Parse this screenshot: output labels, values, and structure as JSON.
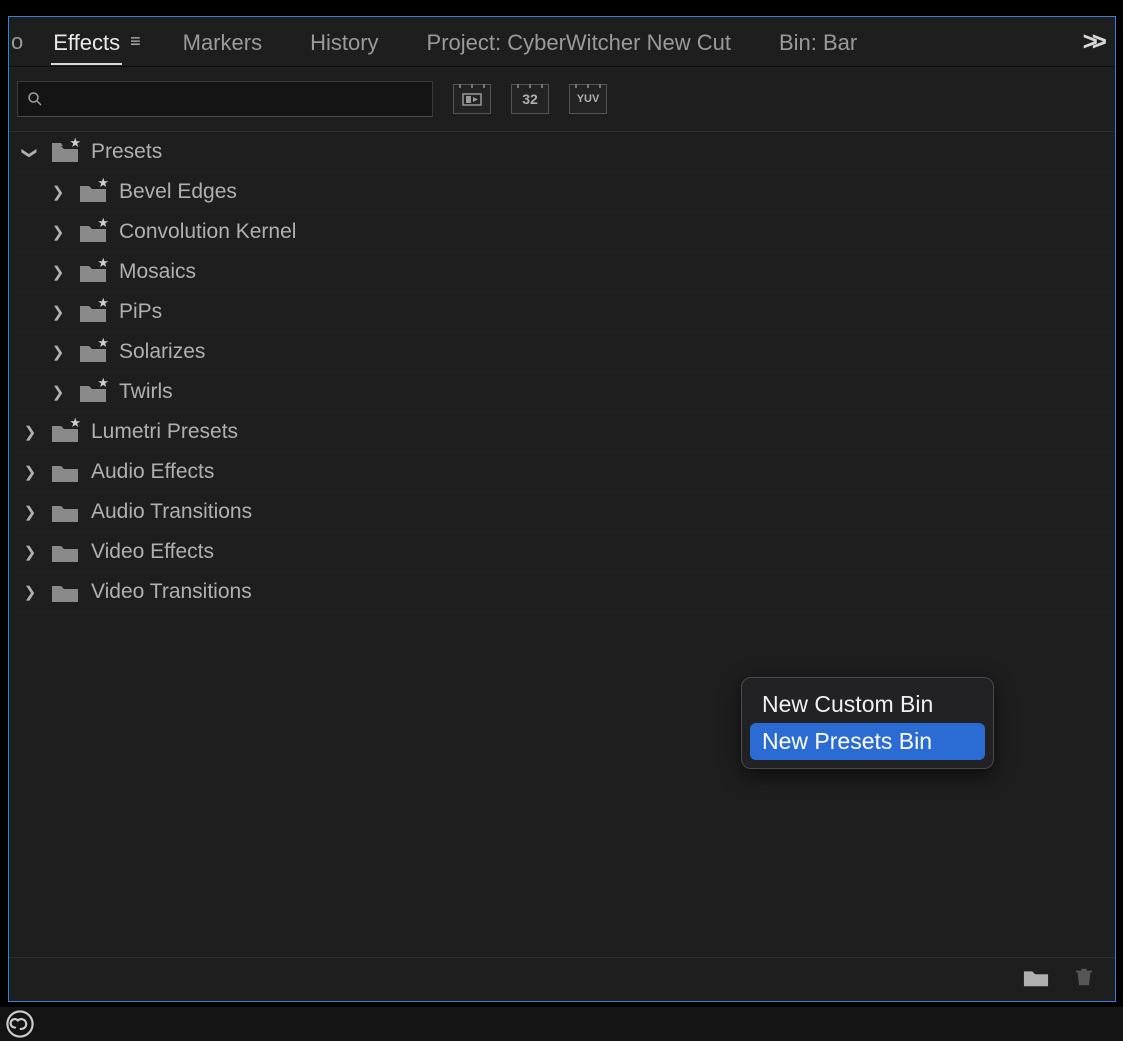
{
  "tabs": {
    "overflow_left_hint": "o",
    "items": [
      {
        "label": "Effects",
        "active": true,
        "has_menu": true
      },
      {
        "label": "Markers"
      },
      {
        "label": "History"
      },
      {
        "label": "Project: CyberWitcher New Cut"
      },
      {
        "label": "Bin: Bar"
      }
    ],
    "overflow_glyph": "»"
  },
  "search": {
    "value": "",
    "placeholder": ""
  },
  "toolbar_buttons": {
    "accelerated": "▶",
    "bit32": "32",
    "yuv": "YUV"
  },
  "tree": [
    {
      "label": "Presets",
      "expanded": true,
      "starred": true,
      "depth": 0,
      "children": [
        {
          "label": "Bevel Edges",
          "starred": true
        },
        {
          "label": "Convolution Kernel",
          "starred": true
        },
        {
          "label": "Mosaics",
          "starred": true
        },
        {
          "label": "PiPs",
          "starred": true
        },
        {
          "label": "Solarizes",
          "starred": true
        },
        {
          "label": "Twirls",
          "starred": true
        }
      ]
    },
    {
      "label": "Lumetri Presets",
      "starred": true,
      "depth": 0
    },
    {
      "label": "Audio Effects",
      "starred": false,
      "depth": 0
    },
    {
      "label": "Audio Transitions",
      "starred": false,
      "depth": 0
    },
    {
      "label": "Video Effects",
      "starred": false,
      "depth": 0
    },
    {
      "label": "Video Transitions",
      "starred": false,
      "depth": 0
    }
  ],
  "context_menu": {
    "items": [
      {
        "label": "New Custom Bin",
        "highlight": false
      },
      {
        "label": "New Presets Bin",
        "highlight": true
      }
    ]
  },
  "footer_icons": {
    "new_bin": "folder",
    "delete": "trash"
  }
}
